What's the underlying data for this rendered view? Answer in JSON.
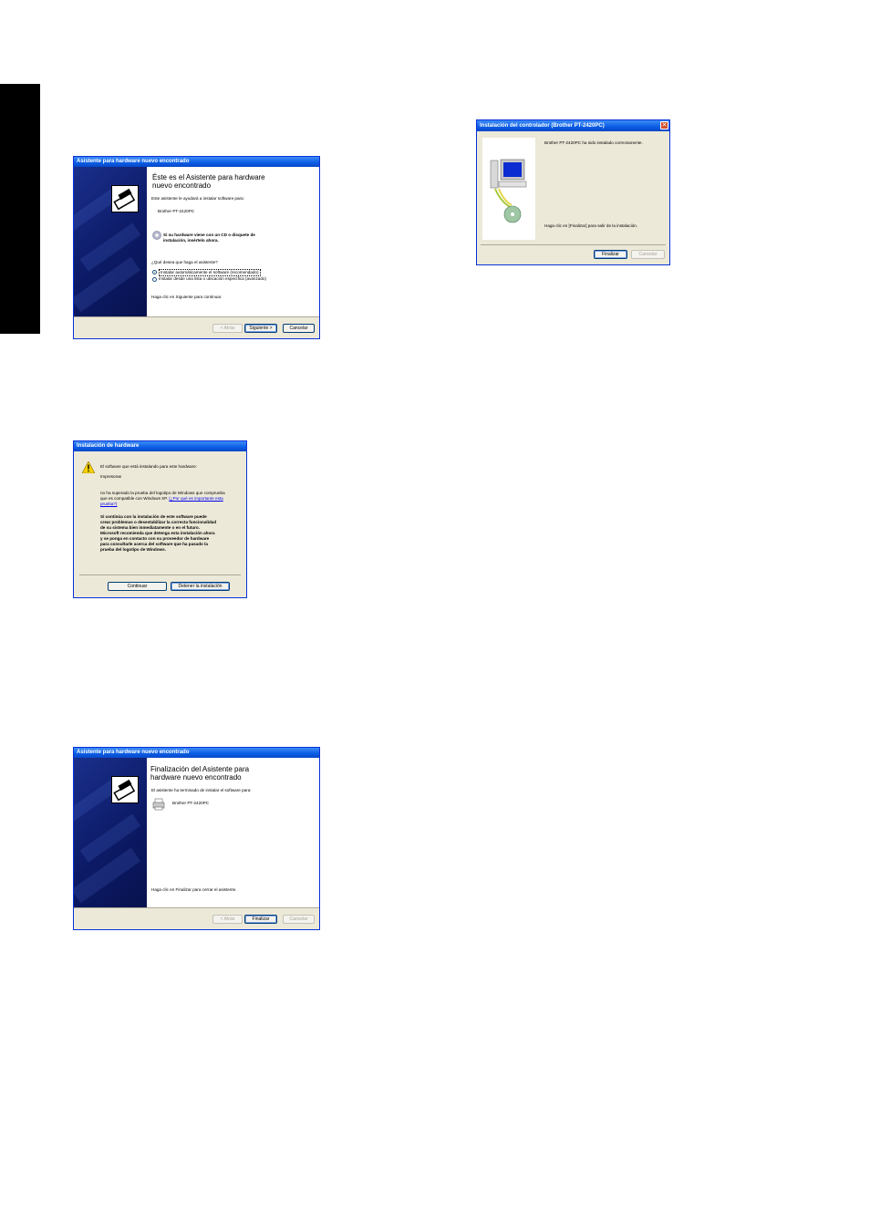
{
  "wizard1": {
    "title": "Asistente para hardware nuevo encontrado",
    "heading": "Éste es el Asistente para hardware\nnuevo encontrado",
    "intro": "Este asistente le ayudará a instalar software para:",
    "device": "Brother PT-2420PC",
    "cd_line1": "Si su hardware viene con un CD o disquete de",
    "cd_line2": "instalación, insértelo ahora.",
    "question": "¿Qué desea que haga el asistente?",
    "option_auto": "Instalar automáticamente el software (recomendado)",
    "option_manual": "Instalar desde una lista o ubicación específica (avanzado)",
    "hint": "Haga clic en Siguiente para continuar.",
    "back_label": "< Atrás",
    "next_label": "Siguiente >",
    "cancel_label": "Cancelar"
  },
  "hwinstall": {
    "title": "Instalación de hardware",
    "line1": "El software que está instalando para este hardware:",
    "device": "Impresoras",
    "logo_line1": "no ha superado la prueba del logotipo de Windows que comprueba",
    "logo_line2": "que es compatible con Windows XP.",
    "logo_link_a": "(¿Por qué es importante esta",
    "logo_link_b": "prueba?)",
    "warn1": "Si continúa con la instalación de este software puede",
    "warn2": "crear problemas o desestabilizar la correcta funcionalidad",
    "warn3": "de su sistema bien inmediatamente o en el futuro.",
    "warn4": "Microsoft recomienda que detenga esta instalación ahora",
    "warn5": "y se ponga en contacto con su proveedor de hardware",
    "warn6": "para consultarle acerca del software que ha pasado la",
    "warn7": "prueba del logotipo de Windows.",
    "continue_label": "Continuar",
    "stop_label": "Detener la instalación"
  },
  "wizard2": {
    "title": "Asistente para hardware nuevo encontrado",
    "heading": "Finalización del Asistente para\nhardware nuevo encontrado",
    "intro": "El asistente ha terminado de instalar el software para:",
    "device": "Brother PT-2420PC",
    "hint": "Haga clic en Finalizar para cerrar el asistente.",
    "back_label": "< Atrás",
    "finish_label": "Finalizar",
    "cancel_label": "Cancelar"
  },
  "driver": {
    "title": "Instalación del controlador (Brother PT-2420PC)",
    "message": "Brother PT-2420PC ha sido instalado correctamente.",
    "hint": "Haga clic en [Finalizar] para salir de la instalación.",
    "finish_label": "Finalizar",
    "cancel_label": "Cancelar",
    "close_glyph": "✕"
  }
}
